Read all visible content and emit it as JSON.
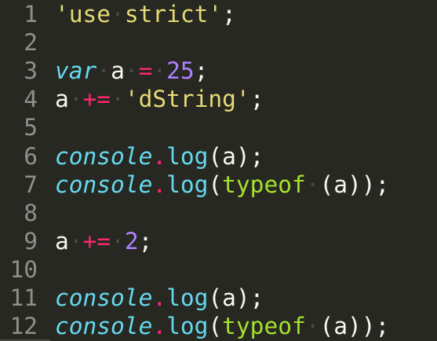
{
  "editor": {
    "theme_colors": {
      "background": "#272822",
      "line_number": "#8f908a",
      "string": "#e6db74",
      "keyword": "#66d9ef",
      "operator": "#f92672",
      "number": "#ae81ff",
      "type": "#a6e22e",
      "text": "#f8f8f2"
    },
    "lines": [
      {
        "n": "1",
        "tokens": [
          {
            "t": "str",
            "v": "'use"
          },
          {
            "t": "ws",
            "v": "·"
          },
          {
            "t": "str",
            "v": "strict'"
          },
          {
            "t": "punc",
            "v": ";"
          }
        ]
      },
      {
        "n": "2",
        "tokens": []
      },
      {
        "n": "3",
        "tokens": [
          {
            "t": "kw",
            "v": "var"
          },
          {
            "t": "ws",
            "v": "·"
          },
          {
            "t": "id",
            "v": "a"
          },
          {
            "t": "ws",
            "v": "·"
          },
          {
            "t": "op",
            "v": "="
          },
          {
            "t": "ws",
            "v": "·"
          },
          {
            "t": "num",
            "v": "25"
          },
          {
            "t": "punc",
            "v": ";"
          }
        ]
      },
      {
        "n": "4",
        "tokens": [
          {
            "t": "id",
            "v": "a"
          },
          {
            "t": "ws",
            "v": "·"
          },
          {
            "t": "op",
            "v": "+="
          },
          {
            "t": "ws",
            "v": "·"
          },
          {
            "t": "str",
            "v": "'dString'"
          },
          {
            "t": "punc",
            "v": ";"
          }
        ]
      },
      {
        "n": "5",
        "tokens": []
      },
      {
        "n": "6",
        "tokens": [
          {
            "t": "obj",
            "v": "console"
          },
          {
            "t": "op",
            "v": "."
          },
          {
            "t": "fn",
            "v": "log"
          },
          {
            "t": "punc",
            "v": "(a);"
          }
        ]
      },
      {
        "n": "7",
        "tokens": [
          {
            "t": "obj",
            "v": "console"
          },
          {
            "t": "op",
            "v": "."
          },
          {
            "t": "fn",
            "v": "log"
          },
          {
            "t": "punc",
            "v": "("
          },
          {
            "t": "type",
            "v": "typeof"
          },
          {
            "t": "ws",
            "v": "·"
          },
          {
            "t": "punc",
            "v": "(a));"
          }
        ]
      },
      {
        "n": "8",
        "tokens": []
      },
      {
        "n": "9",
        "tokens": [
          {
            "t": "id",
            "v": "a"
          },
          {
            "t": "ws",
            "v": "·"
          },
          {
            "t": "op",
            "v": "+="
          },
          {
            "t": "ws",
            "v": "·"
          },
          {
            "t": "num",
            "v": "2"
          },
          {
            "t": "punc",
            "v": ";"
          }
        ]
      },
      {
        "n": "10",
        "tokens": []
      },
      {
        "n": "11",
        "tokens": [
          {
            "t": "obj",
            "v": "console"
          },
          {
            "t": "op",
            "v": "."
          },
          {
            "t": "fn",
            "v": "log"
          },
          {
            "t": "punc",
            "v": "(a);"
          }
        ]
      },
      {
        "n": "12",
        "tokens": [
          {
            "t": "obj",
            "v": "console"
          },
          {
            "t": "op",
            "v": "."
          },
          {
            "t": "fn",
            "v": "log"
          },
          {
            "t": "punc",
            "v": "("
          },
          {
            "t": "type",
            "v": "typeof"
          },
          {
            "t": "ws",
            "v": "·"
          },
          {
            "t": "punc",
            "v": "(a));"
          }
        ]
      }
    ]
  }
}
